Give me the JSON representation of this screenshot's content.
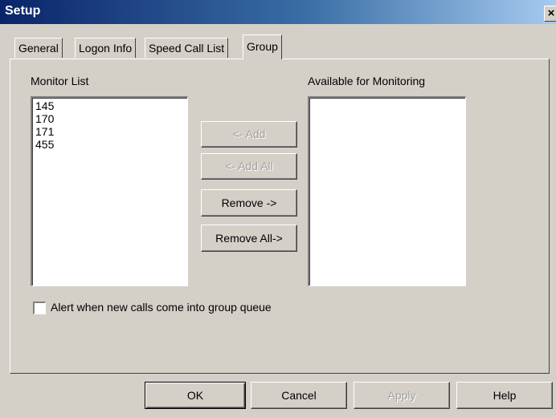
{
  "window": {
    "title": "Setup",
    "close_label": "×"
  },
  "tabs": [
    {
      "label": "General",
      "active": false
    },
    {
      "label": "Logon Info",
      "active": false
    },
    {
      "label": "Speed Call List",
      "active": false
    },
    {
      "label": "Group",
      "active": true
    }
  ],
  "group": {
    "monitor_list_label": "Monitor List",
    "monitor_list": [
      "145",
      "170",
      "171",
      "455"
    ],
    "available_label": "Available for Monitoring",
    "available_list": [],
    "add_label": "<- Add",
    "add_all_label": "<- Add All",
    "remove_label": "Remove ->",
    "remove_all_label": "Remove All->",
    "alert_label": "Alert when new calls come into group queue",
    "alert_checked": false
  },
  "footer": {
    "ok_label": "OK",
    "cancel_label": "Cancel",
    "apply_label": "Apply",
    "help_label": "Help"
  }
}
